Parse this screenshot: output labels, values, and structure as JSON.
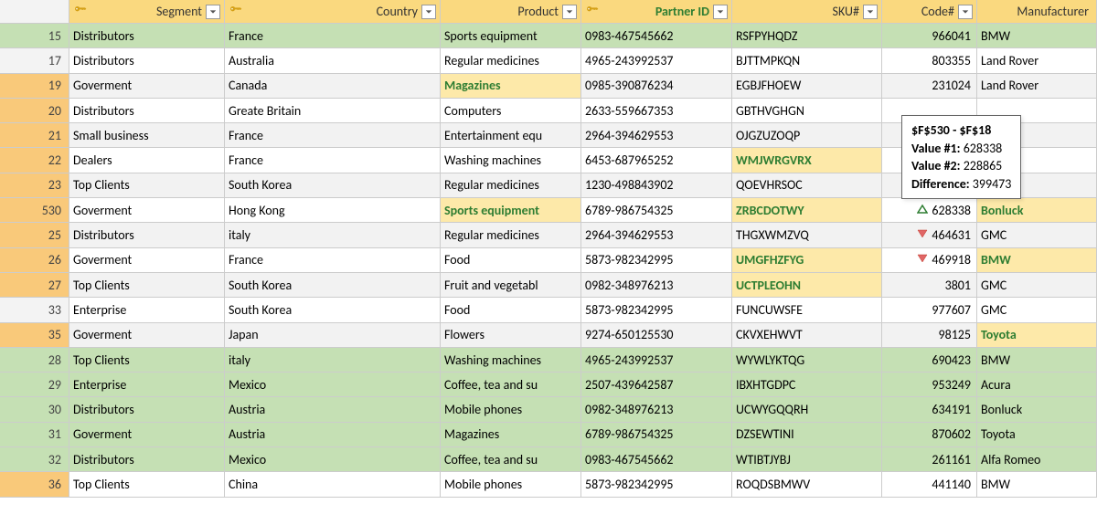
{
  "headers": [
    "Segment",
    "Country",
    "Product",
    "Partner ID",
    "SKU#",
    "Code#",
    "Manufacturer"
  ],
  "key_cols": [
    0,
    1,
    3
  ],
  "green_cols": [
    3
  ],
  "rows": [
    {
      "n": 15,
      "rc": "grn",
      "row": "grn",
      "d": [
        "Distributors",
        "France",
        "Sports equipment",
        "0983-467545662",
        "RSFPYHQDZ",
        "966041",
        "BMW"
      ]
    },
    {
      "n": 17,
      "rc": "",
      "row": "",
      "d": [
        "Distributors",
        "Australia",
        "Regular medicines",
        "4965-243992537",
        "BJTTMPKQN",
        "803355",
        "Land Rover"
      ]
    },
    {
      "n": 19,
      "rc": "yel",
      "row": "alt",
      "d": [
        "Goverment",
        "Canada",
        "Magazines",
        "0985-390876234",
        "EGBJFHOEW",
        "231024",
        "Land Rover"
      ],
      "hl": [
        2
      ]
    },
    {
      "n": 20,
      "rc": "yel",
      "row": "",
      "d": [
        "Distributors",
        "Greate Britain",
        "Computers",
        "2633-559667353",
        "GBTHVGHGN",
        "",
        ""
      ]
    },
    {
      "n": 21,
      "rc": "yel",
      "row": "alt",
      "d": [
        "Small business",
        "France",
        "Entertainment equ",
        "2964-394629553",
        "OJGZUZOQP",
        "",
        ""
      ]
    },
    {
      "n": 22,
      "rc": "yel",
      "row": "",
      "d": [
        "Dealers",
        "France",
        "Washing machines",
        "6453-687965252",
        "WMJWRGVRX",
        "",
        ""
      ],
      "hl": [
        4
      ]
    },
    {
      "n": 23,
      "rc": "yel",
      "row": "alt",
      "d": [
        "Top Clients",
        "South Korea",
        "Regular medicines",
        "1230-498843902",
        "QOEVHRSOC",
        "",
        ""
      ]
    },
    {
      "n": 530,
      "rc": "yel",
      "row": "",
      "d": [
        "Goverment",
        "Hong Kong",
        "Sports equipment",
        "6789-986754325",
        "ZRBCDOTWY",
        "628338",
        "Bonluck"
      ],
      "hl": [
        2,
        4,
        6
      ],
      "tri": "up"
    },
    {
      "n": 25,
      "rc": "yel",
      "row": "alt",
      "d": [
        "Distributors",
        "italy",
        "Regular medicines",
        "2964-394629553",
        "THGXWMZVQ",
        "464631",
        "GMC"
      ],
      "tri": "dn"
    },
    {
      "n": 26,
      "rc": "yel",
      "row": "",
      "d": [
        "Goverment",
        "France",
        "Food",
        "5873-982342995",
        "UMGFHZFYG",
        "469918",
        "BMW"
      ],
      "hl": [
        4,
        6
      ],
      "tri": "dn"
    },
    {
      "n": 27,
      "rc": "yel",
      "row": "alt",
      "d": [
        "Top Clients",
        "South Korea",
        "Fruit and vegetabl",
        "0982-348976213",
        "UCTPLEOHN",
        "3801",
        "GMC"
      ],
      "hl": [
        4
      ]
    },
    {
      "n": 33,
      "rc": "",
      "row": "",
      "d": [
        "Enterprise",
        "South Korea",
        "Food",
        "5873-982342995",
        "FUNCUWSFE",
        "977607",
        "GMC"
      ]
    },
    {
      "n": 35,
      "rc": "yel",
      "row": "alt",
      "d": [
        "Goverment",
        "Japan",
        "Flowers",
        "9274-650125530",
        "CKVXEHWVT",
        "98125",
        "Toyota"
      ],
      "hl": [
        6
      ]
    },
    {
      "n": 28,
      "rc": "grn",
      "row": "grn",
      "d": [
        "Top Clients",
        "italy",
        "Washing machines",
        "4965-243992537",
        "WYWLYKTQG",
        "690423",
        "BMW"
      ]
    },
    {
      "n": 29,
      "rc": "grn",
      "row": "grn",
      "d": [
        "Enterprise",
        "Mexico",
        "Coffee, tea and su",
        "2507-439642587",
        "IBXHTGDPC",
        "953249",
        "Acura"
      ]
    },
    {
      "n": 30,
      "rc": "grn",
      "row": "grn",
      "d": [
        "Distributors",
        "Austria",
        "Mobile phones",
        "0982-348976213",
        "UCWYGQQRH",
        "634191",
        "Bonluck"
      ]
    },
    {
      "n": 31,
      "rc": "grn",
      "row": "grn",
      "d": [
        "Goverment",
        "Austria",
        "Magazines",
        "6789-986754325",
        "DZSEWTINI",
        "870602",
        "Toyota"
      ]
    },
    {
      "n": 32,
      "rc": "grn",
      "row": "grn",
      "d": [
        "Distributors",
        "Mexico",
        "Coffee, tea and su",
        "0983-467545662",
        "WTIBTJYBJ",
        "261161",
        "Alfa Romeo"
      ]
    },
    {
      "n": 36,
      "rc": "yel",
      "row": "",
      "d": [
        "Top Clients",
        "China",
        "Mobile phones",
        "5873-982342995",
        "ROQDSBMWV",
        "441140",
        "BMW"
      ]
    }
  ],
  "tooltip": {
    "title": "$F$530 - $F$18",
    "v1_label": "Value #1:",
    "v1": "628338",
    "v2_label": "Value #2:",
    "v2": "228865",
    "diff_label": "Difference:",
    "diff": "399473"
  }
}
